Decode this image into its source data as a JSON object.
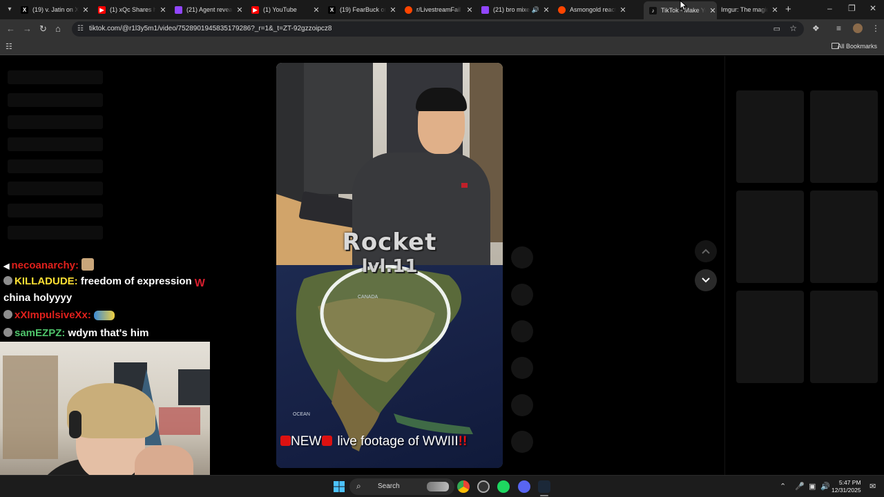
{
  "browser": {
    "tabs": [
      {
        "title": "(19) v. Jatin on X:",
        "favicon": "x-icon",
        "color": "#000000"
      },
      {
        "title": "(1) xQc Shares his",
        "favicon": "youtube-icon",
        "color": "#ff0000"
      },
      {
        "title": "(21) Agent reveal:",
        "favicon": "twitch-icon",
        "color": "#9146ff"
      },
      {
        "title": "(1) YouTube",
        "favicon": "youtube-icon",
        "color": "#ff0000"
      },
      {
        "title": "(19) FearBuck on",
        "favicon": "x-icon",
        "color": "#000000"
      },
      {
        "title": "r/LivestreamFail",
        "favicon": "reddit-icon",
        "color": "#ff4500"
      },
      {
        "title": "(21) bro mixed",
        "favicon": "twitch-icon",
        "color": "#9146ff"
      },
      {
        "title": "Asmongold reacts",
        "favicon": "reddit-icon",
        "color": "#ff4500"
      },
      {
        "title": "TikTok - Make You",
        "favicon": "tiktok-icon",
        "color": "#111111"
      },
      {
        "title": "Imgur: The magic",
        "favicon": "imgur-icon",
        "color": "#1bb76e"
      }
    ],
    "url": "tiktok.com/@r1l3y5m1/video/7528901945835179286?_r=1&_t=ZT-92gzzoipcz8",
    "bookmarks_label": "All Bookmarks"
  },
  "video": {
    "overlay_text_top": "Rocket",
    "overlay_text_level": "lvl.11",
    "map_label_canada": "CANADA",
    "map_label_ocean": "OCEAN",
    "caption": "NEW",
    "caption_rest": "live footage of WWIII",
    "caption_bang": "!!"
  },
  "chat": [
    {
      "user": "necoanarchy:",
      "message": "",
      "color": "#e0201c"
    },
    {
      "user": "KILLADUDE:",
      "message": "freedom of expression",
      "color": "#ffe033"
    },
    {
      "user": "",
      "message": "china holyyyy",
      "color": "#ffffff"
    },
    {
      "user": "xXImpulsiveXx:",
      "message": "",
      "color": "#e0201c"
    },
    {
      "user": "samEZPZ:",
      "message": "wdym that's him",
      "color": "#4fc46b"
    }
  ],
  "taskbar": {
    "search_label": "Search",
    "time": "5:47 PM",
    "date": "12/31/2025"
  },
  "colors": {
    "tab_strip": "#1a1a1a",
    "toolbar": "#333333",
    "page": "#000000",
    "taskbar": "#1c1c1c"
  }
}
